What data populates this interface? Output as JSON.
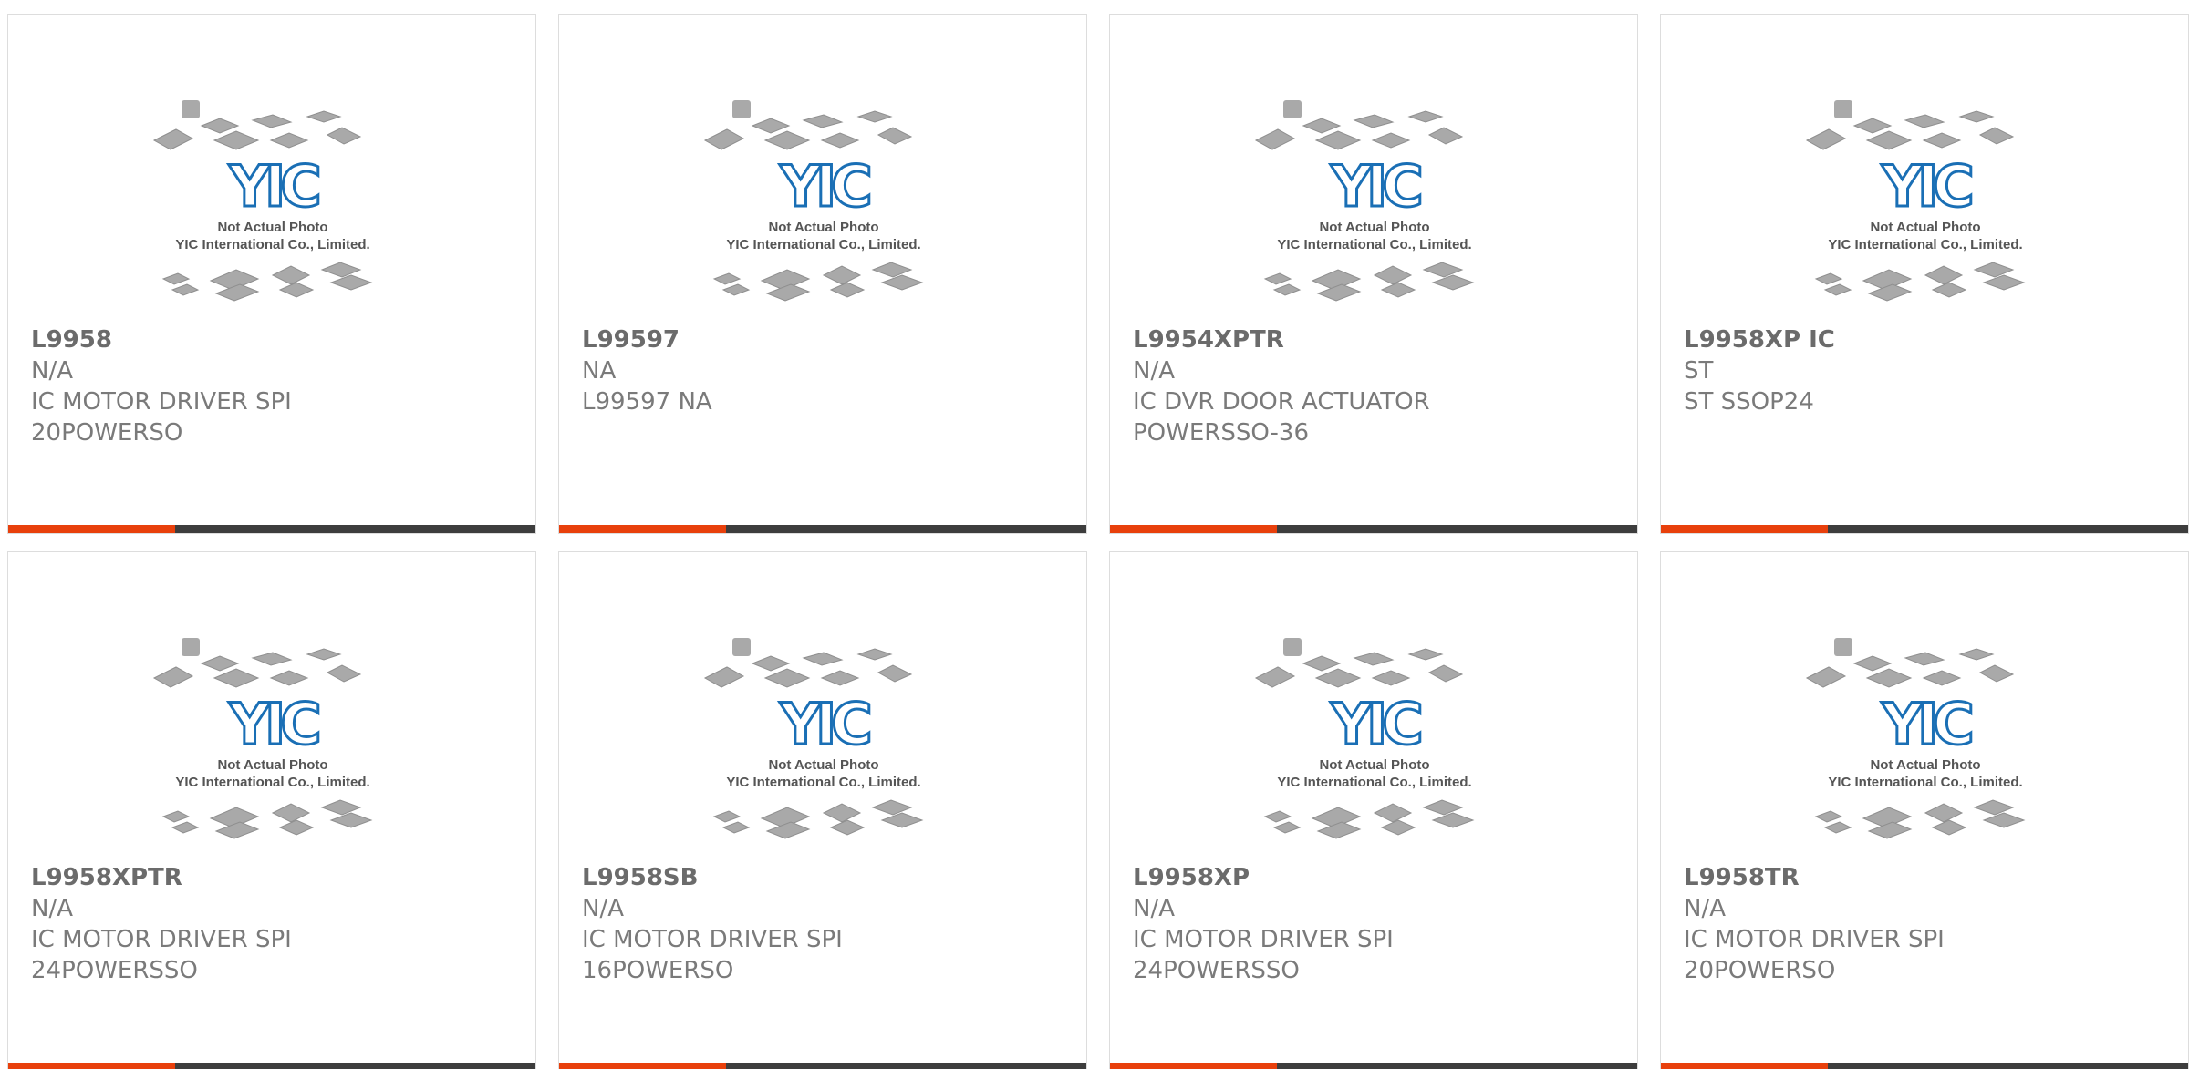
{
  "products": [
    {
      "part": "L9958",
      "mfr": "N/A",
      "desc1": "IC MOTOR DRIVER SPI",
      "desc2": "20POWERSO"
    },
    {
      "part": "L99597",
      "mfr": "NA",
      "desc1": "L99597 NA",
      "desc2": ""
    },
    {
      "part": "L9954XPTR",
      "mfr": "N/A",
      "desc1": "IC DVR DOOR ACTUATOR",
      "desc2": "POWERSSO-36"
    },
    {
      "part": "L9958XP IC",
      "mfr": "ST",
      "desc1": "ST SSOP24",
      "desc2": ""
    },
    {
      "part": "L9958XPTR",
      "mfr": "N/A",
      "desc1": "IC MOTOR DRIVER SPI",
      "desc2": "24POWERSSO"
    },
    {
      "part": "L9958SB",
      "mfr": "N/A",
      "desc1": "IC MOTOR DRIVER SPI",
      "desc2": "16POWERSO"
    },
    {
      "part": "L9958XP",
      "mfr": "N/A",
      "desc1": "IC MOTOR DRIVER SPI",
      "desc2": "24POWERSSO"
    },
    {
      "part": "L9958TR",
      "mfr": "N/A",
      "desc1": "IC MOTOR DRIVER SPI",
      "desc2": "20POWERSO"
    }
  ],
  "placeholder": {
    "logo_text": "YIC",
    "caption1": "Not Actual Photo",
    "caption2": "YIC International Co., Limited."
  },
  "colors": {
    "accent": "#e8400c",
    "bar": "#3d3d3d",
    "logo": "#1a6fb5",
    "chip": "#a9a9a9"
  }
}
